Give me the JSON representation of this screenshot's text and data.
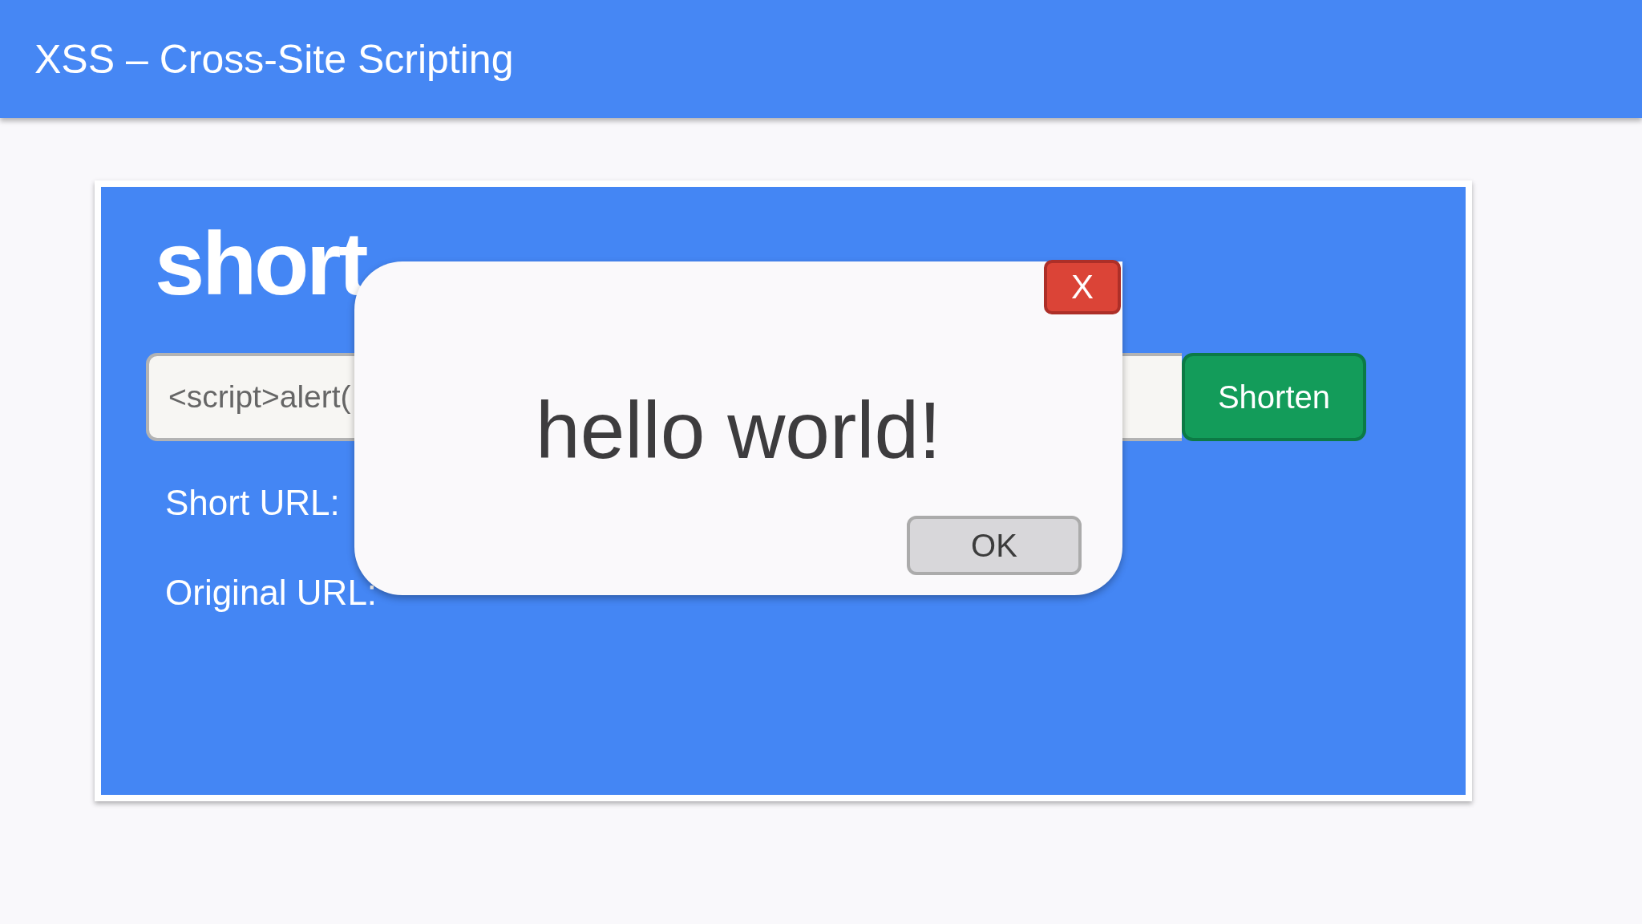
{
  "header": {
    "title": "XSS – Cross-Site Scripting"
  },
  "app": {
    "logo": "short",
    "url_input": {
      "value": "<script>alert("
    },
    "shorten_button": "Shorten",
    "fields": [
      {
        "label": "Short URL:"
      },
      {
        "label": "Original URL:"
      }
    ]
  },
  "alert_dialog": {
    "close_button": "X",
    "message": "hello world!",
    "ok_button": "OK"
  }
}
